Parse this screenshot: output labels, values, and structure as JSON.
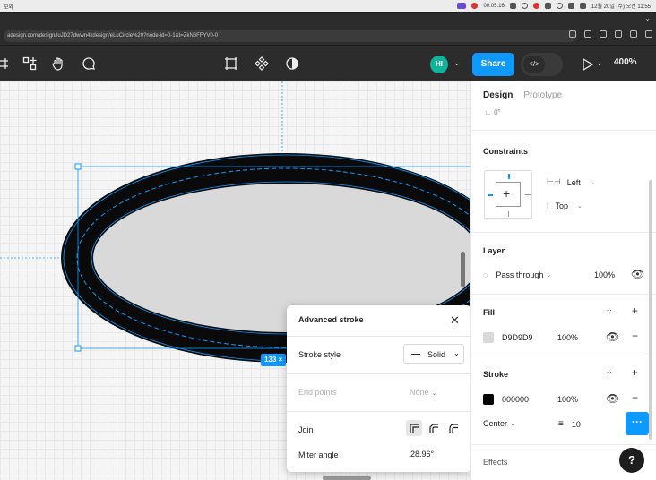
{
  "menubar": {
    "left_text": "모와",
    "timer": "00:05:16",
    "clock": "12월 20일 (수) 오전 11:55"
  },
  "browser": {
    "url": "adesign.com/design/luJD27dwwn4kdesign/eLuCircle%20?node-id=0-1&t=ZkN6FFYV0-0"
  },
  "toolbar": {
    "avatar_initials": "HI",
    "share_label": "Share",
    "dev_label": "</>",
    "zoom_label": "400%",
    "icons": [
      "frame-icon",
      "shape-icon",
      "hand-icon",
      "comment-icon",
      "crop-icon",
      "component-icon",
      "contrast-icon",
      "play-icon"
    ]
  },
  "canvas": {
    "dimension_badge": "133 ×"
  },
  "advanced_stroke": {
    "title": "Advanced stroke",
    "stroke_style_label": "Stroke style",
    "stroke_style_value": "Solid",
    "end_points_label": "End points",
    "end_points_value": "None",
    "join_label": "Join",
    "miter_angle_label": "Miter angle",
    "miter_angle_value": "28.96°"
  },
  "panel": {
    "tabs": [
      "Design",
      "Prototype"
    ],
    "clipped_value": "0°",
    "constraints": {
      "title": "Constraints",
      "horizontal": "Left",
      "vertical": "Top"
    },
    "layer": {
      "title": "Layer",
      "blend": "Pass through",
      "opacity": "100%"
    },
    "fill": {
      "title": "Fill",
      "color_hex": "D9D9D9",
      "swatch": "#D9D9D9",
      "opacity": "100%"
    },
    "stroke": {
      "title": "Stroke",
      "color_hex": "000000",
      "swatch": "#000000",
      "opacity": "100%",
      "position": "Center",
      "weight": "10"
    },
    "effects": {
      "title": "Effects"
    },
    "help_label": "?"
  },
  "colors": {
    "accent": "#0D99FF",
    "toolbar_bg": "#2C2C2C",
    "avatar": "#13B29A"
  }
}
